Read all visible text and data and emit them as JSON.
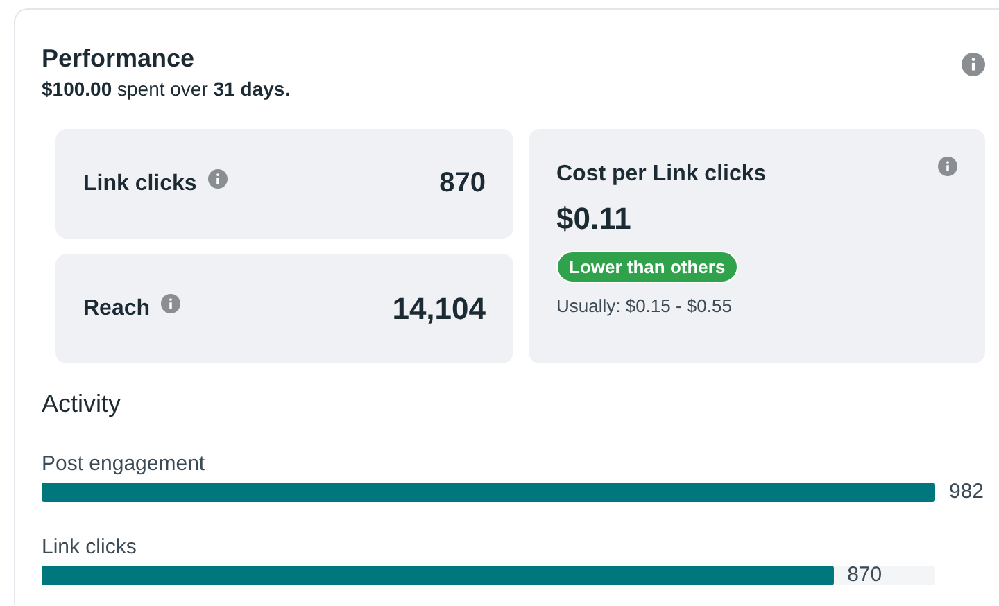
{
  "title": "Performance",
  "summary": "**$100.00** spent over **31 days.**",
  "metrics": [
    {
      "label": "Link clicks",
      "value": "870"
    },
    {
      "label": "Reach",
      "value": "14,104"
    }
  ],
  "cost": {
    "label": "Cost per Link clicks",
    "value": "$0.11",
    "badge": "Lower than others",
    "range": "Usually: $0.15 - $0.55"
  },
  "activity": {
    "title": "Activity",
    "items": [
      {
        "label": "Post engagement",
        "level": 1,
        "value": "982"
      },
      {
        "label": "Link clicks",
        "level": 0.886,
        "value": "870"
      }
    ]
  }
}
